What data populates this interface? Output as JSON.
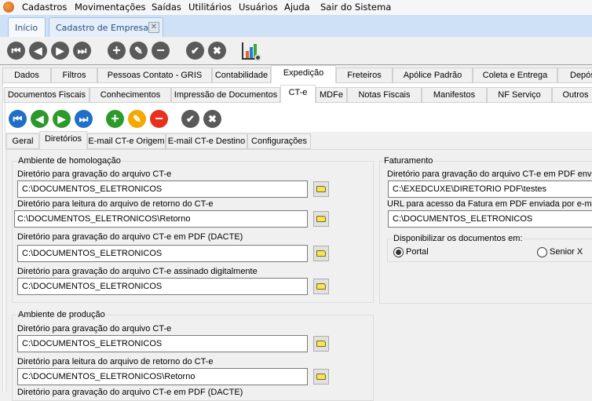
{
  "menu": {
    "items": [
      "Cadastros",
      "Movimentações",
      "Saídas",
      "Utilitários",
      "Usuários",
      "Ajuda",
      "Sair do Sistema"
    ]
  },
  "doc_tabs": [
    {
      "label": "Início"
    },
    {
      "label": "Cadastro de Empresas"
    }
  ],
  "main_tabs": [
    "Dados",
    "Filtros",
    "Pessoas Contato - GRIS",
    "Contabilidade",
    "Expedição",
    "Freteiros",
    "Apólice Padrão",
    "Coleta e Entrega",
    "Depós"
  ],
  "sub_tabs": [
    "Documentos Fiscais",
    "Conhecimentos",
    "Impressão de Documentos",
    "CT-e",
    "MDFe",
    "Notas Fiscais",
    "Manifestos",
    "NF Serviço",
    "Outros"
  ],
  "cte_tabs": [
    "Geral",
    "Diretórios",
    "E-mail CT-e Origem",
    "E-mail CT-e Destino",
    "Configurações"
  ],
  "homolog": {
    "title": "Ambiente de homologação",
    "fields": [
      {
        "label": "Diretório para gravação do arquivo CT-e",
        "value": "C:\\DOCUMENTOS_ELETRONICOS"
      },
      {
        "label": "Diretório para leitura do arquivo de retorno do CT-e",
        "value": "C:\\DOCUMENTOS_ELETRONICOS\\Retorno"
      },
      {
        "label": "Diretório para gravação do arquivo CT-e em PDF (DACTE)",
        "value": "C:\\DOCUMENTOS_ELETRONICOS"
      },
      {
        "label": "Diretório para gravação do arquivo CT-e assinado digitalmente",
        "value": "C:\\DOCUMENTOS_ELETRONICOS"
      }
    ]
  },
  "producao": {
    "title": "Ambiente de produção",
    "fields": [
      {
        "label": "Diretório para gravação do arquivo CT-e",
        "value": "C:\\DOCUMENTOS_ELETRONICOS"
      },
      {
        "label": "Diretório para leitura do arquivo de retorno do CT-e",
        "value": "C:\\DOCUMENTOS_ELETRONICOS\\Retorno"
      },
      {
        "label": "Diretório para gravação do arquivo CT-e em PDF (DACTE)"
      }
    ]
  },
  "faturamento": {
    "title": "Faturamento",
    "fields": [
      {
        "label": "Diretório para gravação do arquivo CT-e em PDF enviado",
        "value": "C:\\EXEDCUXE\\DIRETORIO PDF\\testes"
      },
      {
        "label": "URL para acesso da Fatura em PDF enviada por e-mail",
        "value": "C:\\DOCUMENTOS_ELETRONICOS"
      }
    ],
    "disp": {
      "title": "Disponibilizar os documentos em:",
      "options": [
        "Portal",
        "Senior X"
      ],
      "selected": "Portal"
    }
  }
}
